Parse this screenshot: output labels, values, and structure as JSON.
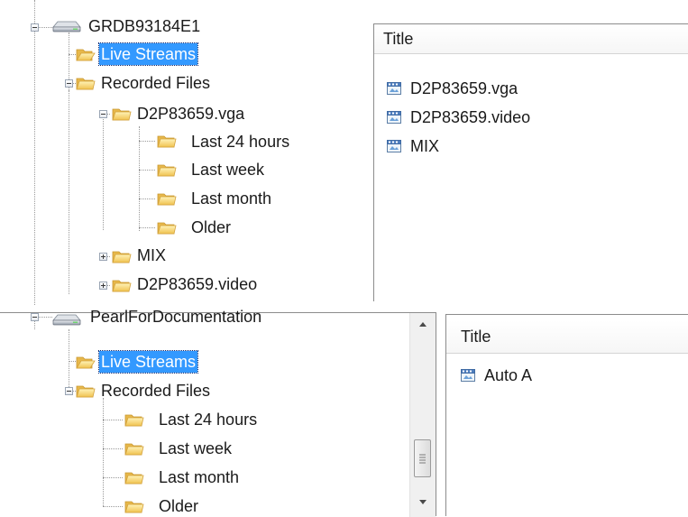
{
  "colors": {
    "selection": "#3399ff",
    "folder": "#f6d67a",
    "tree_lines": "#9a9a9a",
    "panel_border": "#8c8c8c"
  },
  "top": {
    "root_label": "GRDB93184E1",
    "root_icon": "drive-icon",
    "items": {
      "live_streams": "Live Streams",
      "recorded_files": "Recorded Files",
      "vga_folder": "D2P83659.vga",
      "last_24": "Last 24 hours",
      "last_week": "Last week",
      "last_month": "Last month",
      "older": "Older",
      "mix": "MIX",
      "video_folder": "D2P83659.video"
    },
    "list": {
      "header": "Title",
      "rows": [
        "D2P83659.vga",
        "D2P83659.video",
        "MIX"
      ]
    }
  },
  "bottom": {
    "root_label": "PearlForDocumentation",
    "root_icon": "drive-icon",
    "items": {
      "live_streams": "Live Streams",
      "recorded_files": "Recorded Files",
      "last_24": "Last 24 hours",
      "last_week": "Last week",
      "last_month": "Last month",
      "older": "Older"
    },
    "list": {
      "header": "Title",
      "rows": [
        "Auto A"
      ]
    }
  }
}
